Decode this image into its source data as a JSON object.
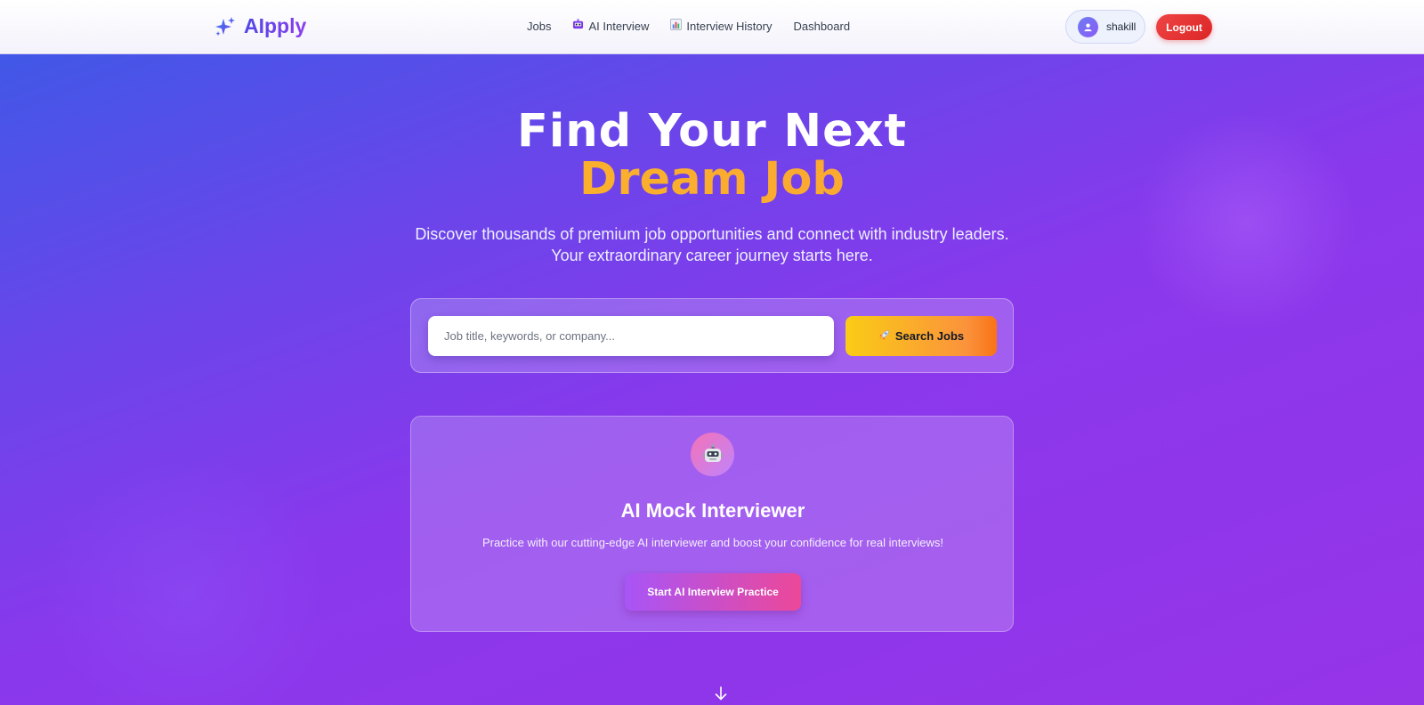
{
  "nav": {
    "logo_text": "AIpply",
    "logo_icon": "sparkles-icon",
    "links": [
      {
        "label": "Jobs",
        "icon": ""
      },
      {
        "label": "AI Interview",
        "icon": "robot-icon"
      },
      {
        "label": "Interview History",
        "icon": "bar-chart-icon"
      },
      {
        "label": "Dashboard",
        "icon": ""
      }
    ],
    "username": "shakill",
    "logout_label": "Logout"
  },
  "hero": {
    "title_line1": "Find Your Next",
    "title_line2": "Dream Job",
    "subtitle_line1": "Discover thousands of premium job opportunities and connect with industry leaders.",
    "subtitle_line2": "Your extraordinary career journey starts here."
  },
  "search": {
    "placeholder": "Job title, keywords, or company...",
    "value": "",
    "button_label": "Search Jobs",
    "button_icon": "rocket-icon"
  },
  "ai_card": {
    "icon": "robot-icon",
    "title": "AI Mock Interviewer",
    "description": "Practice with our cutting-edge AI interviewer and boost your confidence for real interviews!",
    "button_label": "Start AI Interview Practice"
  },
  "scroll_indicator": "arrow-down-icon",
  "colors": {
    "brand": "#5a3fe0",
    "accent_yellow": "#fbbf24",
    "logout_red": "#ef4444",
    "search_button": "#fb923c"
  }
}
